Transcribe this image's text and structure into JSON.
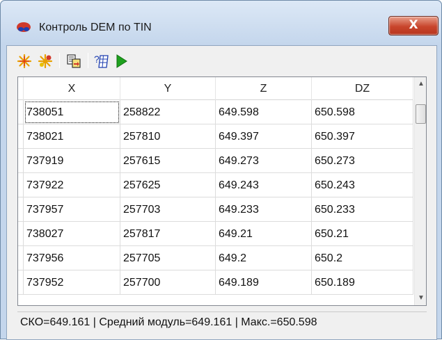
{
  "window": {
    "title": "Контроль DEM по TIN",
    "close_label": "X"
  },
  "toolbar": {
    "buttons": [
      {
        "icon": "asterisk-clear-icon"
      },
      {
        "icon": "asterisk-settings-icon"
      },
      {
        "icon": "copy-export-icon"
      },
      {
        "icon": "help-table-icon"
      },
      {
        "icon": "play-icon"
      }
    ]
  },
  "table": {
    "columns": [
      "X",
      "Y",
      "Z",
      "DZ"
    ],
    "rows": [
      [
        "738051",
        "258822",
        "649.598",
        "650.598"
      ],
      [
        "738021",
        "257810",
        "649.397",
        "650.397"
      ],
      [
        "737919",
        "257615",
        "649.273",
        "650.273"
      ],
      [
        "737922",
        "257625",
        "649.243",
        "650.243"
      ],
      [
        "737957",
        "257703",
        "649.233",
        "650.233"
      ],
      [
        "738027",
        "257817",
        "649.21",
        "650.21"
      ],
      [
        "737956",
        "257705",
        "649.2",
        "650.2"
      ],
      [
        "737952",
        "257700",
        "649.189",
        "650.189"
      ]
    ]
  },
  "status": {
    "text": "СКО=649.161 | Средний модуль=649.161 | Макс.=650.598"
  },
  "colors": {
    "close_button": "#c8452c",
    "play_green": "#1ea11e",
    "title_bar": "#c4d6ec"
  }
}
